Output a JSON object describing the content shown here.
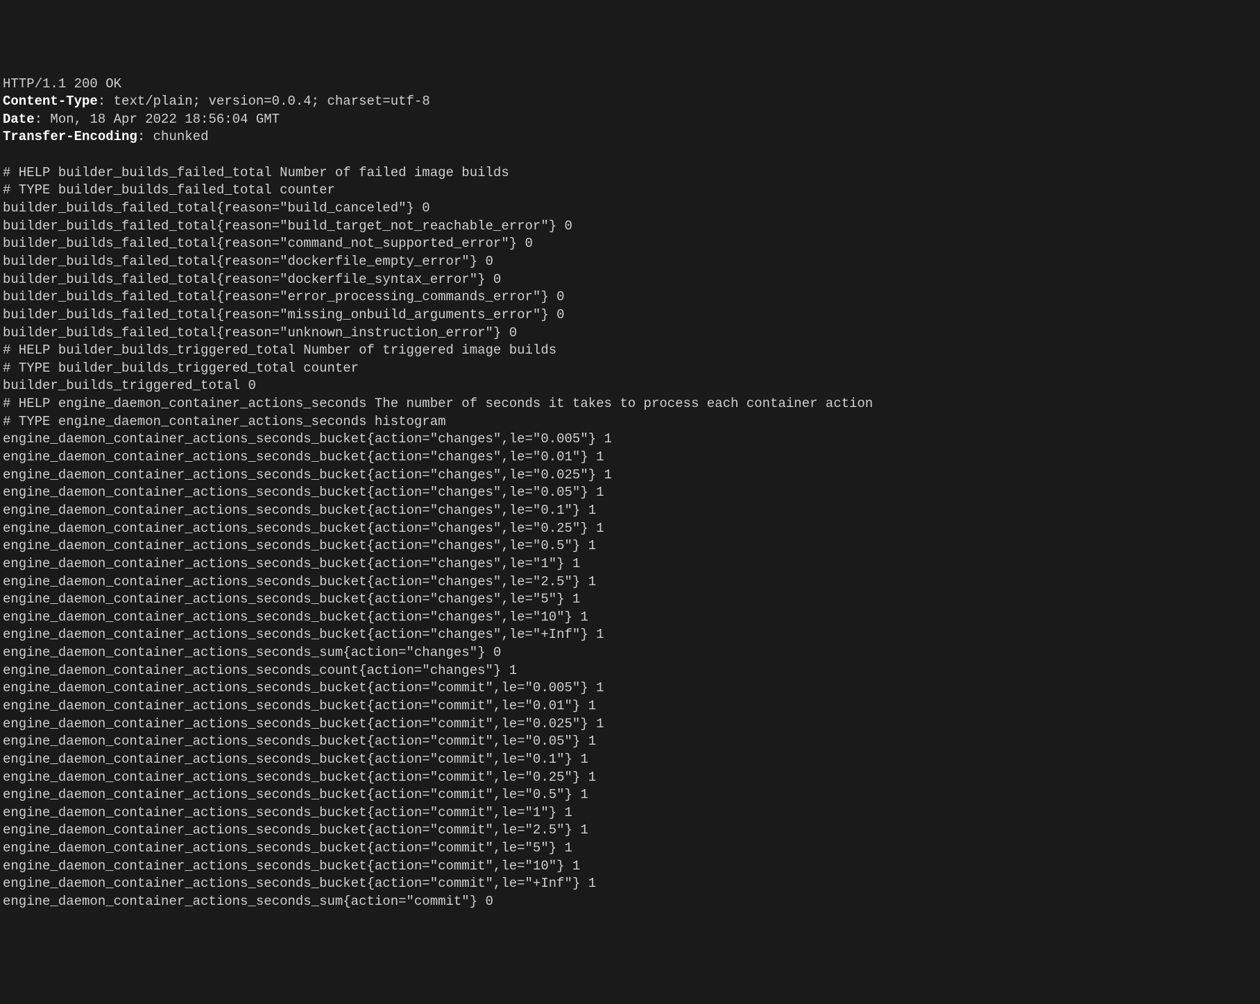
{
  "http": {
    "status_line": "HTTP/1.1 200 OK",
    "headers": [
      {
        "name": "Content-Type",
        "value": "text/plain; version=0.0.4; charset=utf-8"
      },
      {
        "name": "Date",
        "value": "Mon, 18 Apr 2022 18:56:04 GMT"
      },
      {
        "name": "Transfer-Encoding",
        "value": "chunked"
      }
    ]
  },
  "metrics_lines": [
    "# HELP builder_builds_failed_total Number of failed image builds",
    "# TYPE builder_builds_failed_total counter",
    "builder_builds_failed_total{reason=\"build_canceled\"} 0",
    "builder_builds_failed_total{reason=\"build_target_not_reachable_error\"} 0",
    "builder_builds_failed_total{reason=\"command_not_supported_error\"} 0",
    "builder_builds_failed_total{reason=\"dockerfile_empty_error\"} 0",
    "builder_builds_failed_total{reason=\"dockerfile_syntax_error\"} 0",
    "builder_builds_failed_total{reason=\"error_processing_commands_error\"} 0",
    "builder_builds_failed_total{reason=\"missing_onbuild_arguments_error\"} 0",
    "builder_builds_failed_total{reason=\"unknown_instruction_error\"} 0",
    "# HELP builder_builds_triggered_total Number of triggered image builds",
    "# TYPE builder_builds_triggered_total counter",
    "builder_builds_triggered_total 0",
    "# HELP engine_daemon_container_actions_seconds The number of seconds it takes to process each container action",
    "# TYPE engine_daemon_container_actions_seconds histogram",
    "engine_daemon_container_actions_seconds_bucket{action=\"changes\",le=\"0.005\"} 1",
    "engine_daemon_container_actions_seconds_bucket{action=\"changes\",le=\"0.01\"} 1",
    "engine_daemon_container_actions_seconds_bucket{action=\"changes\",le=\"0.025\"} 1",
    "engine_daemon_container_actions_seconds_bucket{action=\"changes\",le=\"0.05\"} 1",
    "engine_daemon_container_actions_seconds_bucket{action=\"changes\",le=\"0.1\"} 1",
    "engine_daemon_container_actions_seconds_bucket{action=\"changes\",le=\"0.25\"} 1",
    "engine_daemon_container_actions_seconds_bucket{action=\"changes\",le=\"0.5\"} 1",
    "engine_daemon_container_actions_seconds_bucket{action=\"changes\",le=\"1\"} 1",
    "engine_daemon_container_actions_seconds_bucket{action=\"changes\",le=\"2.5\"} 1",
    "engine_daemon_container_actions_seconds_bucket{action=\"changes\",le=\"5\"} 1",
    "engine_daemon_container_actions_seconds_bucket{action=\"changes\",le=\"10\"} 1",
    "engine_daemon_container_actions_seconds_bucket{action=\"changes\",le=\"+Inf\"} 1",
    "engine_daemon_container_actions_seconds_sum{action=\"changes\"} 0",
    "engine_daemon_container_actions_seconds_count{action=\"changes\"} 1",
    "engine_daemon_container_actions_seconds_bucket{action=\"commit\",le=\"0.005\"} 1",
    "engine_daemon_container_actions_seconds_bucket{action=\"commit\",le=\"0.01\"} 1",
    "engine_daemon_container_actions_seconds_bucket{action=\"commit\",le=\"0.025\"} 1",
    "engine_daemon_container_actions_seconds_bucket{action=\"commit\",le=\"0.05\"} 1",
    "engine_daemon_container_actions_seconds_bucket{action=\"commit\",le=\"0.1\"} 1",
    "engine_daemon_container_actions_seconds_bucket{action=\"commit\",le=\"0.25\"} 1",
    "engine_daemon_container_actions_seconds_bucket{action=\"commit\",le=\"0.5\"} 1",
    "engine_daemon_container_actions_seconds_bucket{action=\"commit\",le=\"1\"} 1",
    "engine_daemon_container_actions_seconds_bucket{action=\"commit\",le=\"2.5\"} 1",
    "engine_daemon_container_actions_seconds_bucket{action=\"commit\",le=\"5\"} 1",
    "engine_daemon_container_actions_seconds_bucket{action=\"commit\",le=\"10\"} 1",
    "engine_daemon_container_actions_seconds_bucket{action=\"commit\",le=\"+Inf\"} 1",
    "engine_daemon_container_actions_seconds_sum{action=\"commit\"} 0"
  ]
}
